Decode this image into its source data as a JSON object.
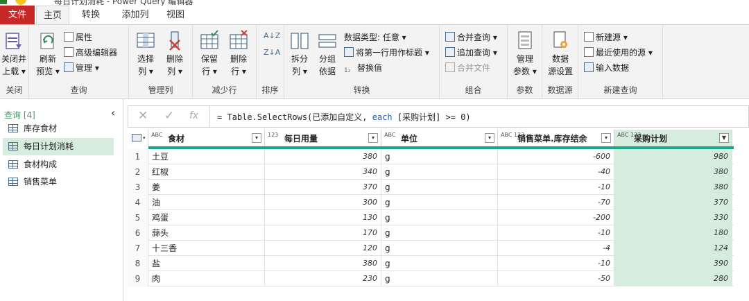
{
  "window": {
    "title": "每日计划消耗 - Power Query 编辑器"
  },
  "tabs": [
    {
      "label": "文件"
    },
    {
      "label": "主页"
    },
    {
      "label": "转换"
    },
    {
      "label": "添加列"
    },
    {
      "label": "视图"
    }
  ],
  "ribbon": {
    "close": {
      "btn1": "关闭并",
      "btn2": "上载",
      "group": "关闭"
    },
    "query": {
      "refresh1": "刷新",
      "refresh2": "预览",
      "properties": "属性",
      "advanced": "高级编辑器",
      "manage": "管理",
      "group": "查询"
    },
    "manage_cols": {
      "choose1": "选择",
      "choose2": "列",
      "remove1": "删除",
      "remove2": "列",
      "group": "管理列"
    },
    "reduce_rows": {
      "keep1": "保留",
      "keep2": "行",
      "remove1": "删除",
      "remove2": "行",
      "group": "减少行"
    },
    "sort": {
      "group": "排序"
    },
    "transform": {
      "split1": "拆分",
      "split2": "列",
      "groupby1": "分组",
      "groupby2": "依据",
      "datatype": "数据类型: 任意",
      "first_row": "将第一行用作标题",
      "replace": "替换值",
      "group": "转换"
    },
    "combine": {
      "merge": "合并查询",
      "append": "追加查询",
      "combine_files": "合并文件",
      "group": "组合"
    },
    "params": {
      "manage1": "管理",
      "manage2": "参数",
      "group": "参数"
    },
    "datasource": {
      "settings1": "数据",
      "settings2": "源设置",
      "group": "数据源"
    },
    "new_query": {
      "new_source": "新建源",
      "recent": "最近使用的源",
      "enter_data": "输入数据",
      "group": "新建查询"
    }
  },
  "queries": {
    "header": "查询 [4]",
    "items": [
      {
        "label": "库存食材"
      },
      {
        "label": "每日计划消耗"
      },
      {
        "label": "食材构成"
      },
      {
        "label": "销售菜单"
      }
    ]
  },
  "formula": {
    "prefix": "= Table.SelectRows(已添加自定义, ",
    "keyword": "each",
    "suffix": " [采购计划] >= 0)"
  },
  "table": {
    "columns": [
      {
        "type": "ABC",
        "name": "食材"
      },
      {
        "type": "123",
        "name": "每日用量"
      },
      {
        "type": "ABC",
        "name": "单位"
      },
      {
        "type": "ABC 123",
        "name": "销售菜单.库存结余"
      },
      {
        "type": "ABC 123",
        "name": "采购计划"
      }
    ],
    "rows": [
      {
        "idx": "1",
        "c1": "土豆",
        "c2": "380",
        "c3": "g",
        "c4": "-600",
        "c5": "980"
      },
      {
        "idx": "2",
        "c1": "红椒",
        "c2": "340",
        "c3": "g",
        "c4": "-40",
        "c5": "380"
      },
      {
        "idx": "3",
        "c1": "姜",
        "c2": "370",
        "c3": "g",
        "c4": "-10",
        "c5": "380"
      },
      {
        "idx": "4",
        "c1": "油",
        "c2": "300",
        "c3": "g",
        "c4": "-70",
        "c5": "370"
      },
      {
        "idx": "5",
        "c1": "鸡蛋",
        "c2": "130",
        "c3": "g",
        "c4": "-200",
        "c5": "330"
      },
      {
        "idx": "6",
        "c1": "蒜头",
        "c2": "170",
        "c3": "g",
        "c4": "-10",
        "c5": "180"
      },
      {
        "idx": "7",
        "c1": "十三香",
        "c2": "120",
        "c3": "g",
        "c4": "-4",
        "c5": "124"
      },
      {
        "idx": "8",
        "c1": "盐",
        "c2": "380",
        "c3": "g",
        "c4": "-10",
        "c5": "390"
      },
      {
        "idx": "9",
        "c1": "肉",
        "c2": "230",
        "c3": "g",
        "c4": "-50",
        "c5": "280"
      }
    ]
  },
  "colors": {
    "file_tab": "#c82828",
    "accent": "#18a889",
    "selected": "#d6ecdf"
  }
}
